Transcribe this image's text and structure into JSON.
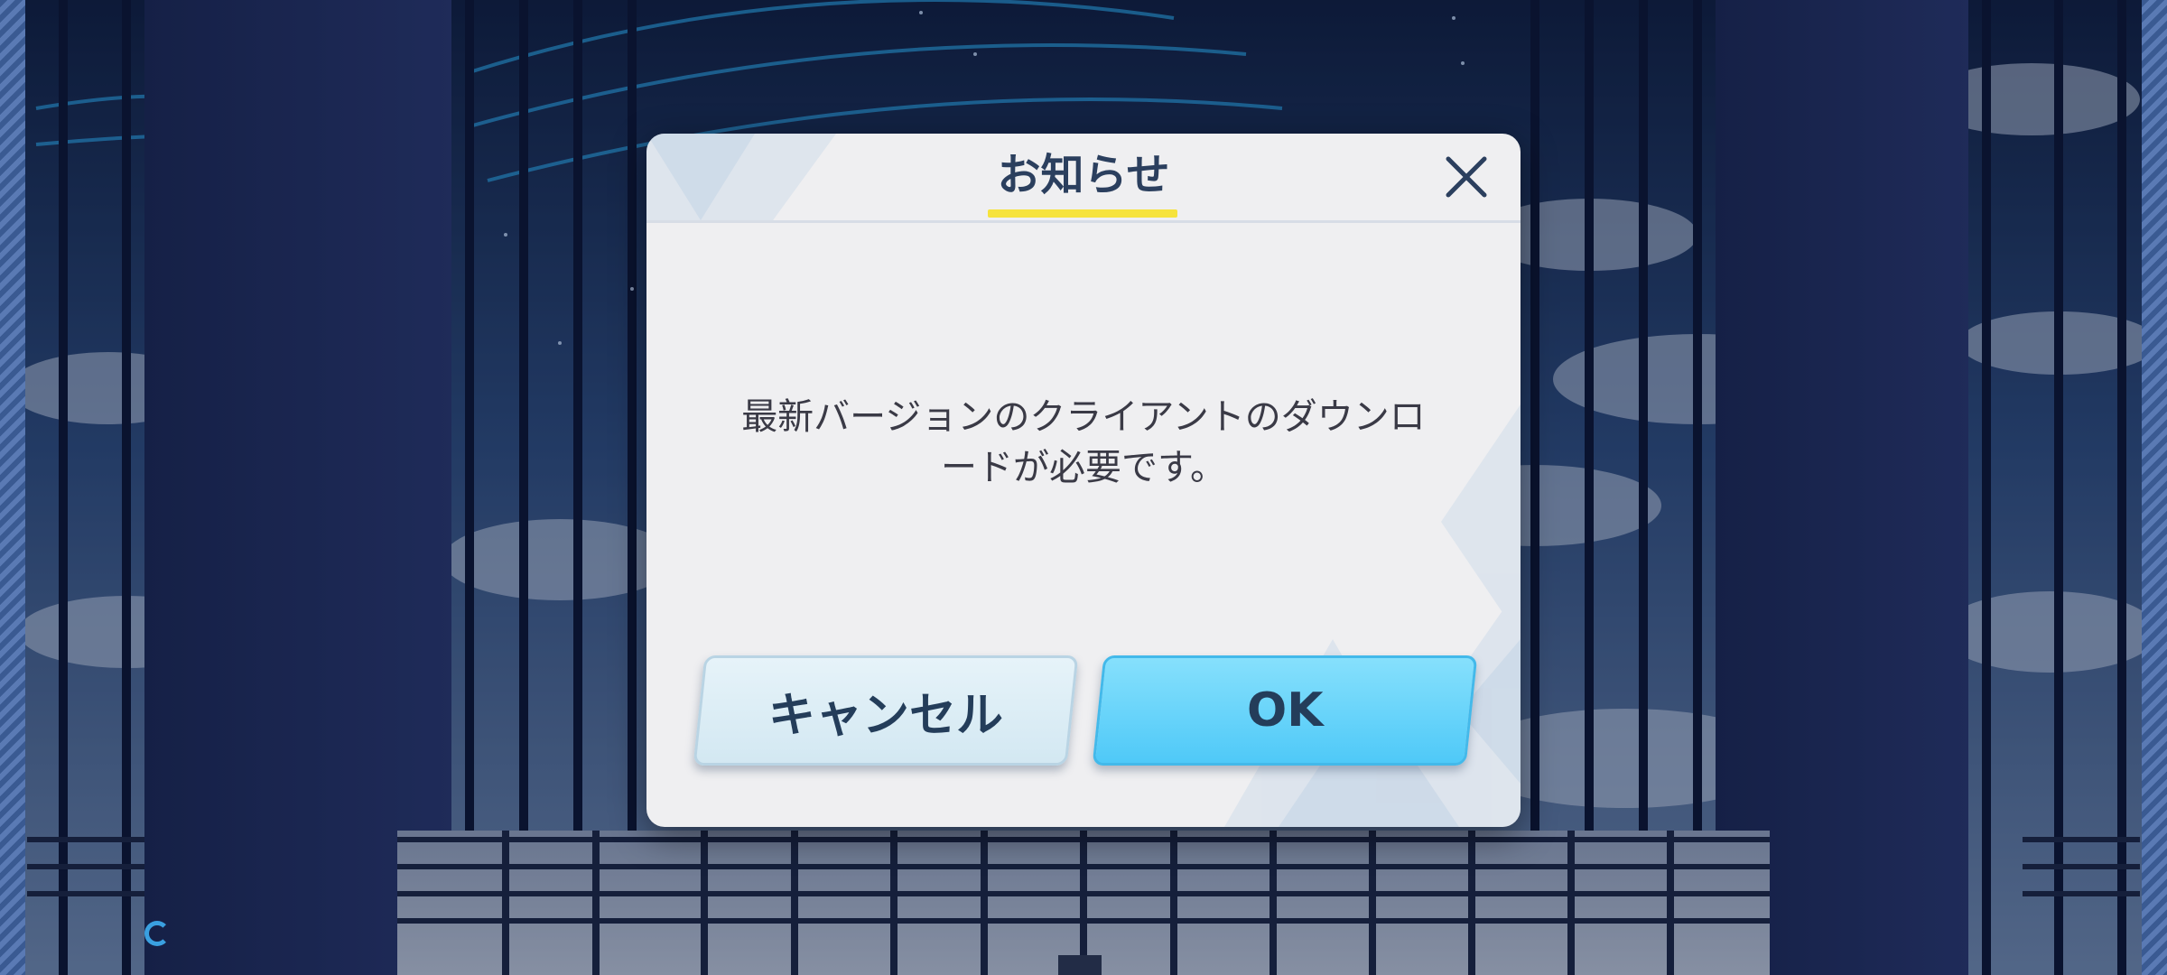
{
  "dialog": {
    "title": "お知らせ",
    "message_line1": "最新バージョンのクライアントのダウンロ",
    "message_line2": "ードが必要です。",
    "cancel_label": "キャンセル",
    "ok_label": "OK",
    "close_icon": "close-icon"
  },
  "colors": {
    "title_text": "#2b3f5e",
    "title_underline": "#f6e33c",
    "ok_button": "#5ccff8",
    "cancel_button": "#dcedf5",
    "dialog_bg": "#efeff1"
  }
}
